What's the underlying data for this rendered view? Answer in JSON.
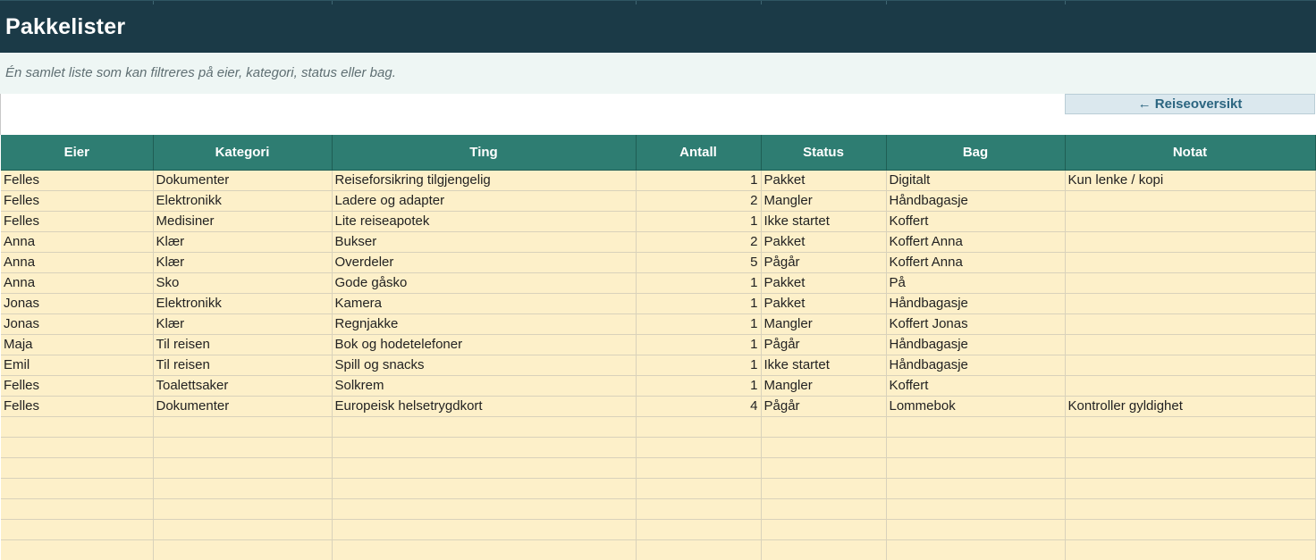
{
  "sheet": {
    "title": "Pakkelister",
    "subtitle": "Én samlet liste som kan filtreres på eier, kategori, status eller bag.",
    "nav_button_label": "← Reiseoversikt"
  },
  "table": {
    "headers": {
      "eier": "Eier",
      "kategori": "Kategori",
      "ting": "Ting",
      "antall": "Antall",
      "status": "Status",
      "bag": "Bag",
      "notat": "Notat"
    },
    "rows": [
      {
        "eier": "Felles",
        "kategori": "Dokumenter",
        "ting": "Reiseforsikring tilgjengelig",
        "antall": "1",
        "status": "Pakket",
        "bag": "Digitalt",
        "notat": "Kun lenke / kopi"
      },
      {
        "eier": "Felles",
        "kategori": "Elektronikk",
        "ting": "Ladere og adapter",
        "antall": "2",
        "status": "Mangler",
        "bag": "Håndbagasje",
        "notat": ""
      },
      {
        "eier": "Felles",
        "kategori": "Medisiner",
        "ting": "Lite reiseapotek",
        "antall": "1",
        "status": "Ikke startet",
        "bag": "Koffert",
        "notat": ""
      },
      {
        "eier": "Anna",
        "kategori": "Klær",
        "ting": "Bukser",
        "antall": "2",
        "status": "Pakket",
        "bag": "Koffert Anna",
        "notat": ""
      },
      {
        "eier": "Anna",
        "kategori": "Klær",
        "ting": "Overdeler",
        "antall": "5",
        "status": "Pågår",
        "bag": "Koffert Anna",
        "notat": ""
      },
      {
        "eier": "Anna",
        "kategori": "Sko",
        "ting": "Gode gåsko",
        "antall": "1",
        "status": "Pakket",
        "bag": "På",
        "notat": ""
      },
      {
        "eier": "Jonas",
        "kategori": "Elektronikk",
        "ting": "Kamera",
        "antall": "1",
        "status": "Pakket",
        "bag": "Håndbagasje",
        "notat": ""
      },
      {
        "eier": "Jonas",
        "kategori": "Klær",
        "ting": "Regnjakke",
        "antall": "1",
        "status": "Mangler",
        "bag": "Koffert Jonas",
        "notat": ""
      },
      {
        "eier": "Maja",
        "kategori": "Til reisen",
        "ting": "Bok og hodetelefoner",
        "antall": "1",
        "status": "Pågår",
        "bag": "Håndbagasje",
        "notat": ""
      },
      {
        "eier": "Emil",
        "kategori": "Til reisen",
        "ting": "Spill og snacks",
        "antall": "1",
        "status": "Ikke startet",
        "bag": "Håndbagasje",
        "notat": ""
      },
      {
        "eier": "Felles",
        "kategori": "Toalettsaker",
        "ting": "Solkrem",
        "antall": "1",
        "status": "Mangler",
        "bag": "Koffert",
        "notat": ""
      },
      {
        "eier": "Felles",
        "kategori": "Dokumenter",
        "ting": "Europeisk helsetrygdkort",
        "antall": "4",
        "status": "Pågår",
        "bag": "Lommebok",
        "notat": "Kontroller gyldighet"
      },
      {
        "eier": "",
        "kategori": "",
        "ting": "",
        "antall": "",
        "status": "",
        "bag": "",
        "notat": ""
      },
      {
        "eier": "",
        "kategori": "",
        "ting": "",
        "antall": "",
        "status": "",
        "bag": "",
        "notat": ""
      },
      {
        "eier": "",
        "kategori": "",
        "ting": "",
        "antall": "",
        "status": "",
        "bag": "",
        "notat": ""
      },
      {
        "eier": "",
        "kategori": "",
        "ting": "",
        "antall": "",
        "status": "",
        "bag": "",
        "notat": ""
      },
      {
        "eier": "",
        "kategori": "",
        "ting": "",
        "antall": "",
        "status": "",
        "bag": "",
        "notat": ""
      },
      {
        "eier": "",
        "kategori": "",
        "ting": "",
        "antall": "",
        "status": "",
        "bag": "",
        "notat": ""
      },
      {
        "eier": "",
        "kategori": "",
        "ting": "",
        "antall": "",
        "status": "",
        "bag": "",
        "notat": ""
      }
    ]
  },
  "colors": {
    "title_bg": "#1b3a47",
    "subtitle_bg": "#eef6f4",
    "header_bg": "#2e7d72",
    "row_bg": "#fdf0c9",
    "nav_button_bg": "#dbe8ee",
    "nav_button_text": "#2b6580"
  }
}
